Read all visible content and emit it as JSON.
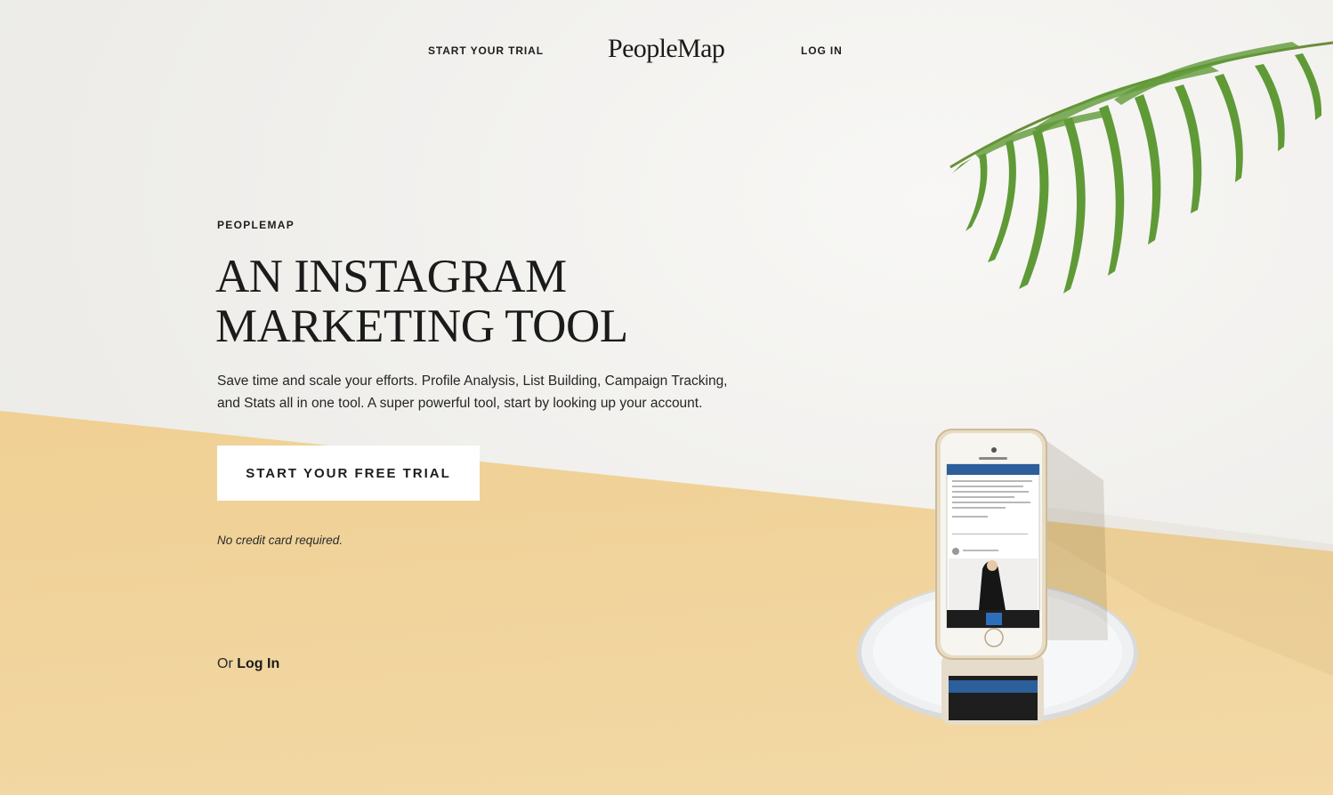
{
  "header": {
    "trial_link": "START YOUR TRIAL",
    "logo": "PeopleMap",
    "login_link": "LOG IN"
  },
  "hero": {
    "eyebrow": "PEOPLEMAP",
    "headline_line1": "AN INSTAGRAM",
    "headline_line2": "MARKETING TOOL",
    "description": "Save time and scale your efforts. Profile Analysis, List Building, Campaign Tracking, and Stats all in one tool. A super powerful tool, start by looking up your account.",
    "cta_label": "START YOUR FREE TRIAL",
    "note": "No credit card required.",
    "or_text": "Or",
    "login_label": "Log In"
  },
  "colors": {
    "wall": "#f2f1ee",
    "floor": "#efcf92",
    "leaf": "#5f9a37",
    "button_bg": "#ffffff",
    "text": "#1b1b1b"
  },
  "icons": [
    "palm-leaf-illustration",
    "phone-illustration",
    "mirror-illustration"
  ]
}
